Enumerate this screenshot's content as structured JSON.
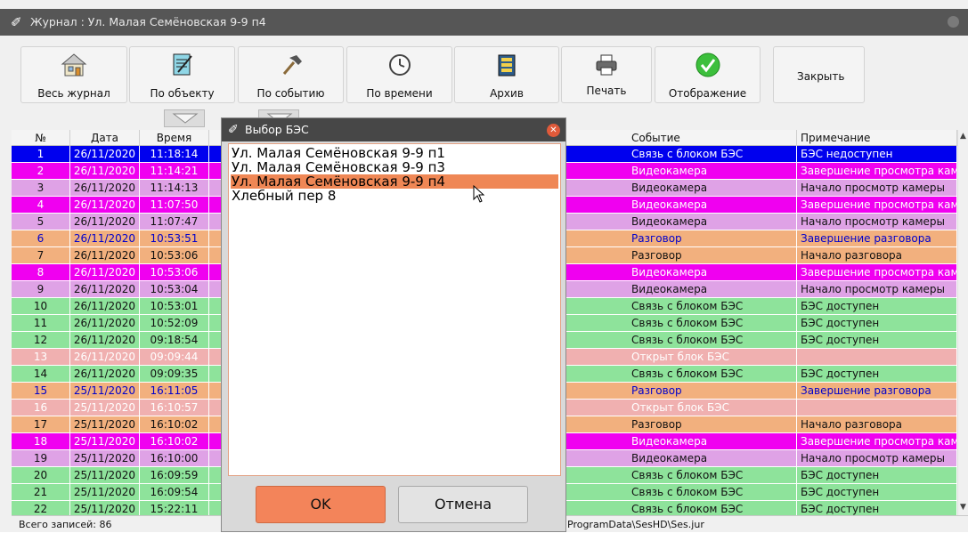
{
  "window": {
    "title": "Журнал : Ул. Малая Семёновская 9-9 п4"
  },
  "toolbar": {
    "buttons": [
      {
        "label": "Весь журнал",
        "icon": "house-icon"
      },
      {
        "label": "По объекту",
        "icon": "notepad-icon"
      },
      {
        "label": "По событию",
        "icon": "hammer-icon"
      },
      {
        "label": "По времени",
        "icon": "clock-icon"
      },
      {
        "label": "Архив",
        "icon": "archive-icon"
      },
      {
        "label": "Печать",
        "icon": "printer-icon"
      },
      {
        "label": "Отображение",
        "icon": "checkmark-icon"
      },
      {
        "label": "Закрыть",
        "icon": ""
      }
    ]
  },
  "table": {
    "headers": [
      "№",
      "Дата",
      "Время",
      "Событие",
      "Примечание"
    ],
    "rows": [
      {
        "n": "1",
        "date": "26/11/2020",
        "time": "11:18:14",
        "event": "Связь с блоком БЭС",
        "note": "БЭС недоступен"
      },
      {
        "n": "2",
        "date": "26/11/2020",
        "time": "11:14:21",
        "event": "Видеокамера",
        "note": "Завершение просмотра камеры"
      },
      {
        "n": "3",
        "date": "26/11/2020",
        "time": "11:14:13",
        "event": "Видеокамера",
        "note": "Начало просмотр камеры"
      },
      {
        "n": "4",
        "date": "26/11/2020",
        "time": "11:07:50",
        "event": "Видеокамера",
        "note": "Завершение просмотра камеры"
      },
      {
        "n": "5",
        "date": "26/11/2020",
        "time": "11:07:47",
        "event": "Видеокамера",
        "note": "Начало просмотр камеры"
      },
      {
        "n": "6",
        "date": "26/11/2020",
        "time": "10:53:51",
        "event": "Разговор",
        "note": "Завершение разговора"
      },
      {
        "n": "7",
        "date": "26/11/2020",
        "time": "10:53:06",
        "event": "Разговор",
        "note": "Начало разговора"
      },
      {
        "n": "8",
        "date": "26/11/2020",
        "time": "10:53:06",
        "event": "Видеокамера",
        "note": "Завершение просмотра камеры"
      },
      {
        "n": "9",
        "date": "26/11/2020",
        "time": "10:53:04",
        "event": "Видеокамера",
        "note": "Начало просмотр камеры"
      },
      {
        "n": "10",
        "date": "26/11/2020",
        "time": "10:53:01",
        "event": "Связь с блоком БЭС",
        "note": "БЭС доступен"
      },
      {
        "n": "11",
        "date": "26/11/2020",
        "time": "10:52:09",
        "event": "Связь с блоком БЭС",
        "note": "БЭС доступен"
      },
      {
        "n": "12",
        "date": "26/11/2020",
        "time": "09:18:54",
        "event": "Связь с блоком БЭС",
        "note": "БЭС доступен"
      },
      {
        "n": "13",
        "date": "26/11/2020",
        "time": "09:09:44",
        "event": "Открыт блок БЭС",
        "note": ""
      },
      {
        "n": "14",
        "date": "26/11/2020",
        "time": "09:09:35",
        "event": "Связь с блоком БЭС",
        "note": "БЭС доступен"
      },
      {
        "n": "15",
        "date": "25/11/2020",
        "time": "16:11:05",
        "event": "Разговор",
        "note": "Завершение разговора"
      },
      {
        "n": "16",
        "date": "25/11/2020",
        "time": "16:10:57",
        "event": "Открыт блок БЭС",
        "note": ""
      },
      {
        "n": "17",
        "date": "25/11/2020",
        "time": "16:10:02",
        "event": "Разговор",
        "note": "Начало разговора"
      },
      {
        "n": "18",
        "date": "25/11/2020",
        "time": "16:10:02",
        "event": "Видеокамера",
        "note": "Завершение просмотра камеры"
      },
      {
        "n": "19",
        "date": "25/11/2020",
        "time": "16:10:00",
        "event": "Видеокамера",
        "note": "Начало просмотр камеры"
      },
      {
        "n": "20",
        "date": "25/11/2020",
        "time": "16:09:59",
        "event": "Связь с блоком БЭС",
        "note": "БЭС доступен"
      },
      {
        "n": "21",
        "date": "25/11/2020",
        "time": "16:09:54",
        "event": "Связь с блоком БЭС",
        "note": "БЭС доступен"
      },
      {
        "n": "22",
        "date": "25/11/2020",
        "time": "15:22:11",
        "event": "Связь с блоком БЭС",
        "note": "БЭС доступен"
      }
    ]
  },
  "colors": {
    "selected": "#0000ee",
    "magenta": "#f000f0",
    "lilac": "#dfa2e6",
    "orange": "#f2b07e",
    "green": "#8ee39b",
    "pink": "#f0b0b0"
  },
  "status": {
    "records": "Всего записей: 86",
    "path": "ProgramData\\SesHD\\Ses.jur"
  },
  "dialog": {
    "title": "Выбор БЭС",
    "items": [
      "Ул. Малая Семёновская 9-9 п1",
      "Ул. Малая Семёновская 9-9 п3",
      "Ул. Малая Семёновская 9-9 п4",
      "Хлебный пер 8"
    ],
    "selected_index": 2,
    "ok_label": "OK",
    "cancel_label": "Отмена"
  }
}
